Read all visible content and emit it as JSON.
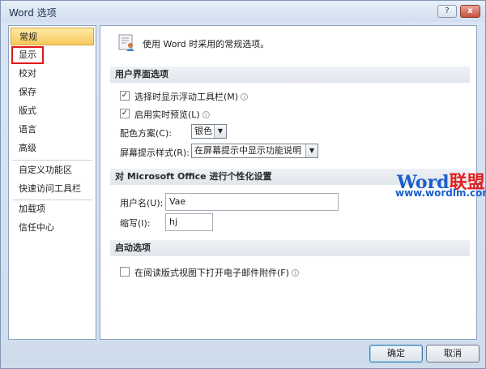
{
  "window": {
    "title": "Word 选项"
  },
  "titlebar_buttons": {
    "help": "?",
    "close": "x"
  },
  "sidebar": {
    "items": [
      {
        "label": "常规"
      },
      {
        "label": "显示"
      },
      {
        "label": "校对"
      },
      {
        "label": "保存"
      },
      {
        "label": "版式"
      },
      {
        "label": "语言"
      },
      {
        "label": "高级"
      },
      {
        "label": "自定义功能区"
      },
      {
        "label": "快速访问工具栏"
      },
      {
        "label": "加载项"
      },
      {
        "label": "信任中心"
      }
    ]
  },
  "main": {
    "header": "使用 Word 时采用的常规选项。",
    "ui_section": {
      "title": "用户界面选项",
      "floating_toolbar": {
        "label": "选择时显示浮动工具栏(M)",
        "checked": true
      },
      "live_preview": {
        "label": "启用实时预览(L)",
        "checked": true
      },
      "color_scheme": {
        "label": "配色方案(C):",
        "value": "银色"
      },
      "screentip": {
        "label": "屏幕提示样式(R):",
        "value": "在屏幕提示中显示功能说明"
      }
    },
    "personalize_section": {
      "title": "对 Microsoft Office 进行个性化设置",
      "username": {
        "label": "用户名(U):",
        "value": "Vae"
      },
      "initials": {
        "label": "缩写(I):",
        "value": "hj"
      }
    },
    "startup_section": {
      "title": "启动选项",
      "reading_view": {
        "label": "在阅读版式视图下打开电子邮件附件(F)",
        "checked": false
      }
    }
  },
  "watermark": {
    "brand_word": "Word",
    "brand_cn": "联盟",
    "url": "www.wordlm.com"
  },
  "buttons": {
    "ok": "确定",
    "cancel": "取消"
  }
}
